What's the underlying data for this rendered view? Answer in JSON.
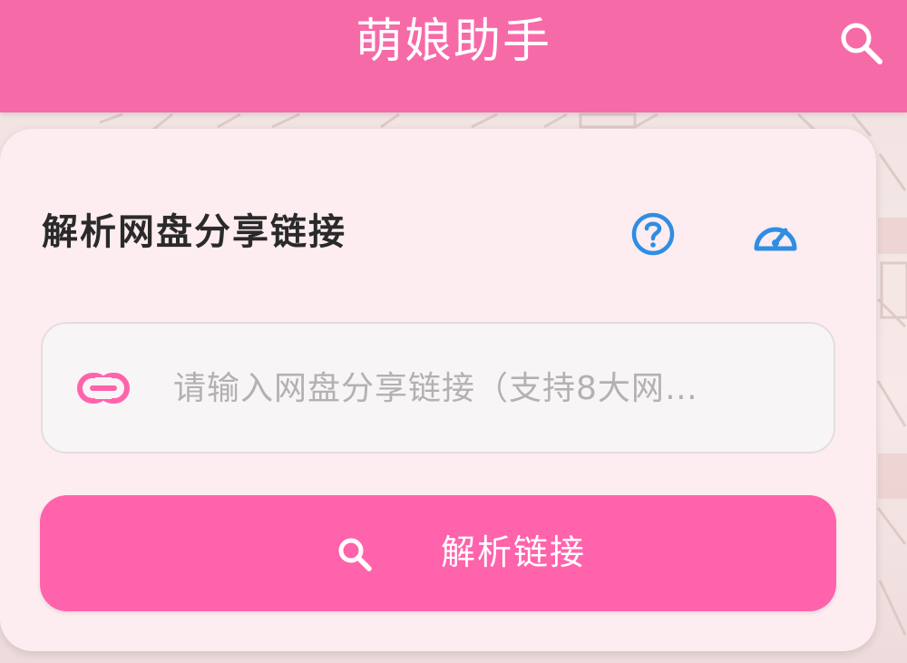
{
  "app_bar": {
    "title": "萌娘助手",
    "search_icon": "search-icon",
    "color": "#f76aa8"
  },
  "card": {
    "title": "解析网盘分享链接",
    "help_icon": "help-circle-icon",
    "speed_icon": "speedometer-icon",
    "icon_color": "#2f8de4"
  },
  "url_field": {
    "icon": "link-icon",
    "icon_color": "#ff63ac",
    "value": "",
    "placeholder": "请输入网盘分享链接（支持8大网…"
  },
  "parse_button": {
    "icon": "search-icon",
    "label": "解析链接",
    "color": "#ff63ac"
  }
}
